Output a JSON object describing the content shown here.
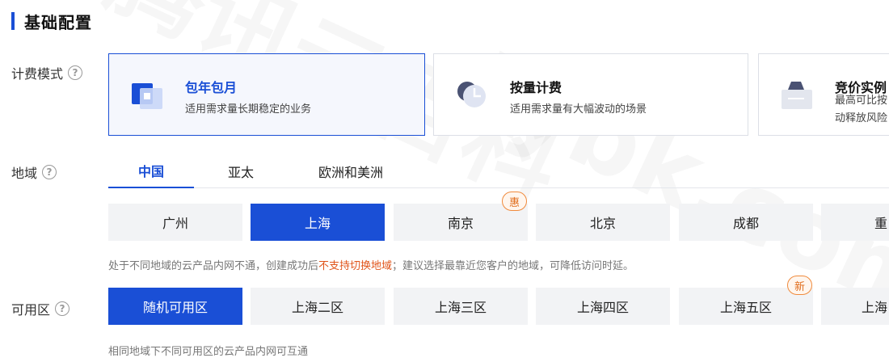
{
  "section": {
    "title": "基础配置"
  },
  "billing": {
    "label": "计费模式",
    "help_icon": "?",
    "cards": [
      {
        "title": "包年包月",
        "desc": "适用需求量长期稳定的业务",
        "icon": "calendar-icon",
        "selected": true
      },
      {
        "title": "按量计费",
        "desc": "适用需求量有大幅波动的场景",
        "icon": "clock-icon",
        "selected": false
      },
      {
        "title": "竞价实例",
        "desc": "最高可比按",
        "desc2": "动释放风险",
        "icon": "tag-icon",
        "selected": false
      }
    ]
  },
  "region": {
    "label": "地域",
    "help_icon": "?",
    "tabs": [
      {
        "label": "中国"
      },
      {
        "label": "亚太"
      },
      {
        "label": "欧洲和美洲"
      }
    ],
    "cities": [
      {
        "label": "广州"
      },
      {
        "label": "上海"
      },
      {
        "label": "南京",
        "badge": "惠"
      },
      {
        "label": "北京"
      },
      {
        "label": "成都"
      },
      {
        "label": "重"
      }
    ],
    "hint_pre": "处于不同地域的云产品内网不通，创建成功后",
    "hint_warn": "不支持切换地域",
    "hint_post": "；建议选择最靠近您客户的地域，可降低访问时延。"
  },
  "zone": {
    "label": "可用区",
    "help_icon": "?",
    "options": [
      {
        "label": "随机可用区"
      },
      {
        "label": "上海二区"
      },
      {
        "label": "上海三区"
      },
      {
        "label": "上海四区"
      },
      {
        "label": "上海五区",
        "badge": "新"
      },
      {
        "label": "上海"
      }
    ],
    "hint": "相同地域下不同可用区的云产品内网可互通"
  },
  "colors": {
    "accent": "#1a4fd6",
    "badge": "#f08a3c",
    "warn": "#e0541a"
  }
}
